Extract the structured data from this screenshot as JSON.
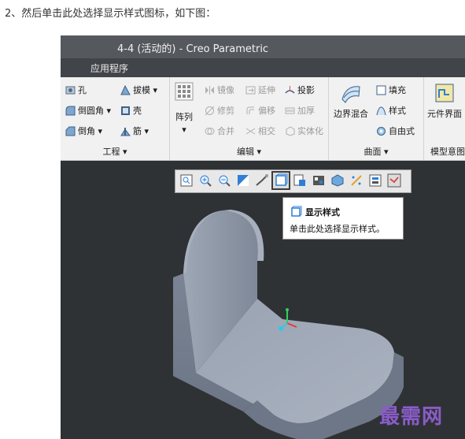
{
  "caption": "2、然后单击此处选择显示样式图标，如下图：",
  "window": {
    "title": "4-4 (活动的) - Creo Parametric"
  },
  "menu": {
    "app_label": "应用程序"
  },
  "ribbon": {
    "engineering": {
      "title": "工程 ▾",
      "hole": "孔",
      "draft": "拔模 ▾",
      "round": "倒圆角 ▾",
      "shell": "壳",
      "chamfer": "倒角 ▾",
      "rib": "筋 ▾"
    },
    "editing": {
      "title": "编辑 ▾",
      "pattern": "阵列",
      "mirror": "镜像",
      "extend": "延伸",
      "project": "投影",
      "trim": "修剪",
      "offset": "偏移",
      "thicken": "加厚",
      "merge": "合并",
      "intersect": "相交",
      "solidify": "实体化"
    },
    "surfaces": {
      "title": "曲面 ▾",
      "boundary_blend": "边界混合",
      "fill": "填充",
      "style": "样式",
      "freestyle": "自由式"
    },
    "model_intent": {
      "title": "模型意图",
      "component_interface": "元件界面"
    }
  },
  "tooltip": {
    "title": "显示样式",
    "description": "单击此处选择显示样式。"
  },
  "watermark": "最需网",
  "colors": {
    "viewport": "#2f3235",
    "model": "#8e98a8",
    "tooltip_icon": "#2f7fd6",
    "watermark": "#8a5cc8"
  }
}
